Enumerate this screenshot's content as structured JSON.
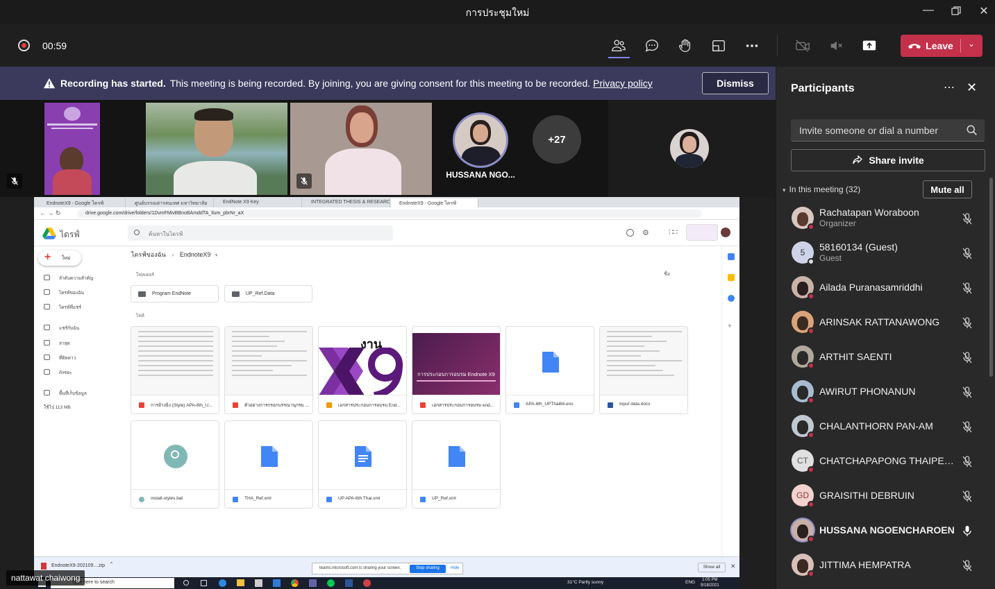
{
  "window": {
    "title": "การประชุมใหม่"
  },
  "toolbar": {
    "timer": "00:59",
    "leave_label": "Leave"
  },
  "banner": {
    "heading": "Recording has started.",
    "message": "This meeting is being recorded. By joining, you are giving consent for this meeting to be recorded.",
    "link": "Privacy policy",
    "dismiss_label": "Dismiss"
  },
  "video_strip": {
    "featured_name": "HUSSANA NGO...",
    "overflow_count": "+27"
  },
  "share": {
    "presenter_name": "nattawat chaiwong",
    "tabs": [
      "EndnoteX9 - Google ไดรฟ์",
      "ศูนย์บรรณสารสนเทศ มหาวิทยาลัย",
      "EndNote X9 Key",
      "INTEGRATED THESIS & RESEARCH",
      "EndnoteX9 - Google ไดรฟ์"
    ],
    "url": "drive.google.com/drive/folders/1DvmFMivBBnoBAmddTA_Ilum_pbrNr_aX",
    "drive_title": "ไดรฟ์",
    "search_placeholder": "ค้นหาในไดรฟ์",
    "new_label": "ใหม่",
    "sidebar": [
      "ลำดับความสำคัญ",
      "ไดรฟ์ของฉัน",
      "ไดรฟ์ที่แชร์",
      "แชร์กับฉัน",
      "ล่าสุด",
      "ที่ติดดาว",
      "ถังขยะ",
      "พื้นที่เก็บข้อมูล",
      "ใช้ไป 113 MB"
    ],
    "breadcrumb_root": "ไดรฟ์ของฉัน",
    "breadcrumb_current": "EndnoteX9",
    "folders_label": "โฟลเดอร์",
    "files_label": "ไฟล์",
    "sort_label": "ชื่อ",
    "folders": [
      "Program EndNote",
      "UP_Ref.Data"
    ],
    "files": [
      "การอ้างอิง (Style) APA-6th_U...",
      "ตัวอย่างการกรอกบรรณานุกรม ...",
      "เอกสารประกอบการอบรม End...",
      "เอกสารประกอบการอบรม end...",
      "APA-6th_UPThai64.ens",
      "Input data.docx",
      "install-styles.bat",
      "THA_Ref.xml",
      "UP APA-6th Thai.xml",
      "UP_Ref.xml"
    ],
    "x9_text": "งาน",
    "slide_text": "การประกอบการอบรม Endnote X9",
    "download_file": "EndnoteX9-202109....zip",
    "sharing_text": "teams.microsoft.com is sharing your screen.",
    "stop_sharing": "Stop sharing",
    "hide": "Hide",
    "show_all": "Show all",
    "taskbar_search": "Type here to search",
    "weather": "31°C  Partly sunny",
    "lang": "ENG",
    "clock_time": "1:05 PM",
    "clock_date": "9/18/2021"
  },
  "panel": {
    "title": "Participants",
    "invite_placeholder": "Invite someone or dial a number",
    "share_invite": "Share invite",
    "in_meeting": "In this meeting (32)",
    "mute_all": "Mute all",
    "participants": [
      {
        "name": "Rachatapan Woraboon",
        "role": "Organizer",
        "initials": "",
        "avatar_color": "#d8c7c0",
        "muted": true
      },
      {
        "name": "58160134 (Guest)",
        "role": "Guest",
        "initials": "5",
        "avatar_color": "#cfd3e8",
        "muted": true
      },
      {
        "name": "Ailada Puranasamriddhi",
        "role": "",
        "initials": "",
        "avatar_color": "#c9b3a8",
        "muted": true
      },
      {
        "name": "ARINSAK RATTANAWONG",
        "role": "",
        "initials": "",
        "avatar_color": "#d9a37a",
        "muted": true
      },
      {
        "name": "ARTHIT SAENTI",
        "role": "",
        "initials": "",
        "avatar_color": "#b0a89a",
        "muted": true
      },
      {
        "name": "AWIRUT PHONANUN",
        "role": "",
        "initials": "",
        "avatar_color": "#a8bccf",
        "muted": true
      },
      {
        "name": "CHALANTHORN PAN-AM",
        "role": "",
        "initials": "",
        "avatar_color": "#c0c8d0",
        "muted": true
      },
      {
        "name": "CHATCHAPAPONG THAIPETK...",
        "role": "",
        "initials": "CT",
        "avatar_color": "#e0e0e0",
        "muted": true
      },
      {
        "name": "GRAISITHI DEBRUIN",
        "role": "",
        "initials": "GD",
        "avatar_color": "#f1d2cc",
        "muted": true
      },
      {
        "name": "HUSSANA NGOENCHAROEN",
        "role": "",
        "initials": "",
        "avatar_color": "#c8b0a8",
        "muted": false
      },
      {
        "name": "JITTIMA HEMPATRA",
        "role": "",
        "initials": "",
        "avatar_color": "#d8c0b8",
        "muted": true
      }
    ]
  }
}
